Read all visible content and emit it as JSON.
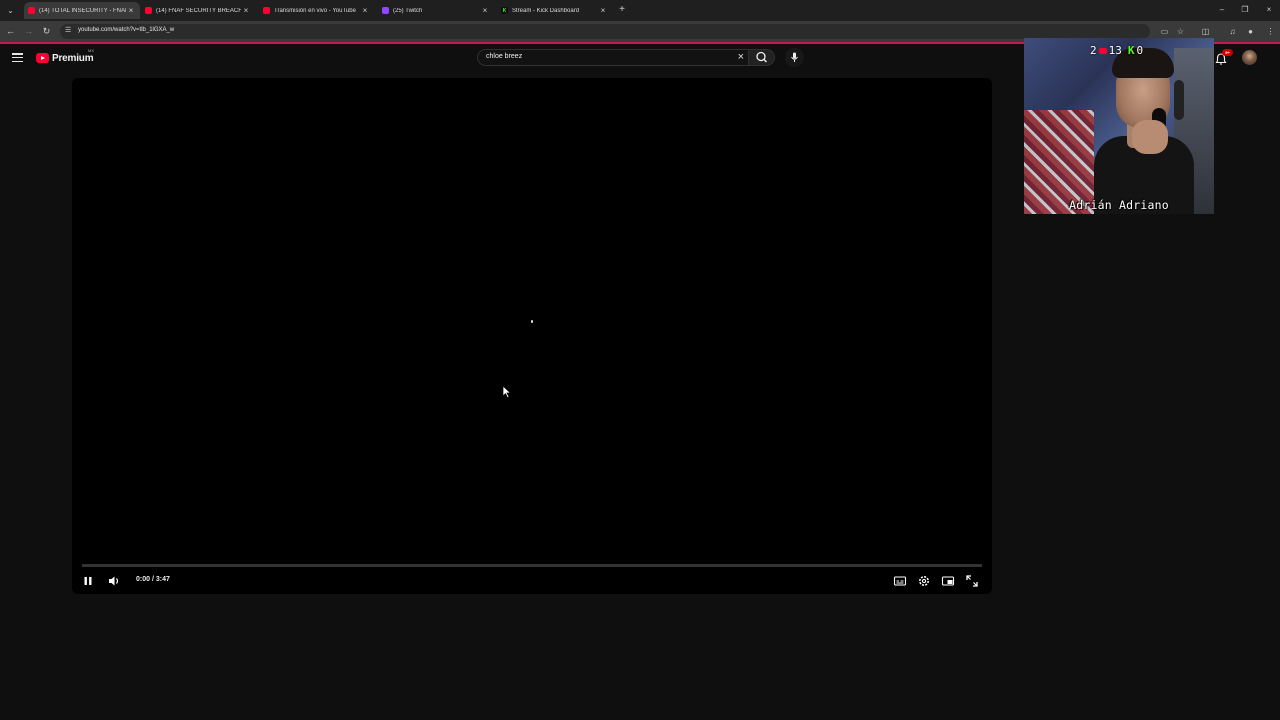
{
  "browser": {
    "tabs": [
      {
        "title": "(14) TOTAL INSECURITY - FNAF",
        "favicon": "youtube-icon",
        "active": true
      },
      {
        "title": "(14) FNAF SECURITY BREACH 3",
        "favicon": "youtube-icon",
        "active": false
      },
      {
        "title": "Transmisión en vivo - YouTube",
        "favicon": "youtube-icon",
        "active": false
      },
      {
        "title": "(25) Twitch",
        "favicon": "twitch-icon",
        "active": false
      },
      {
        "title": "Stream - Kick Dashboard",
        "favicon": "kick-icon",
        "active": false
      }
    ],
    "address": {
      "url": "youtube.com/watch?v=tlb_1lGXA_w"
    },
    "colors": {
      "accent_line": "#c21a52"
    }
  },
  "youtube": {
    "logo": {
      "word": "Premium",
      "region": "MX"
    },
    "search": {
      "query": "chloe breez"
    },
    "notifications": {
      "badge": "9+"
    }
  },
  "player": {
    "time": "0:00 / 3:47",
    "progress_fraction": 0.0
  },
  "webcam": {
    "stats": {
      "ring_partial": "2",
      "youtube_viewers": "13",
      "kick_viewers": "0"
    },
    "streamer_name": "Adrián Adriano"
  }
}
